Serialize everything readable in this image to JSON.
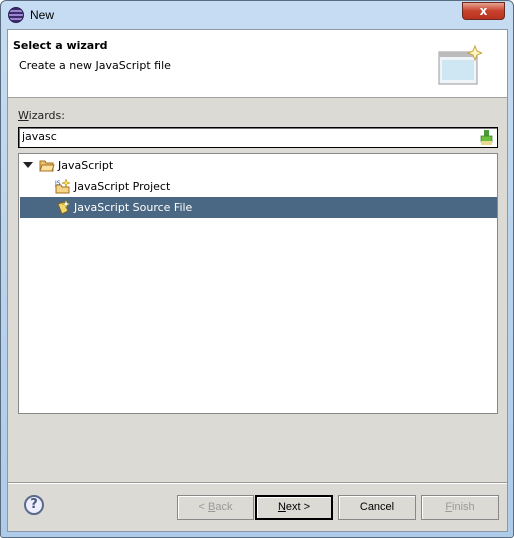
{
  "window": {
    "title": "New",
    "close_label": "x"
  },
  "header": {
    "title": "Select a wizard",
    "description": "Create a new JavaScript file"
  },
  "wizards": {
    "label_mnemonic": "W",
    "label_rest": "izards:",
    "filter_value": "javasc"
  },
  "tree": {
    "items": [
      {
        "label": "JavaScript",
        "icon": "folder-open-icon",
        "expanded": true
      },
      {
        "label": "JavaScript Project",
        "icon": "javascript-project-icon"
      },
      {
        "label": "JavaScript Source File",
        "icon": "javascript-file-icon",
        "selected": true
      }
    ]
  },
  "buttons": {
    "back": {
      "pre": "< ",
      "mn": "B",
      "post": "ack",
      "enabled": false
    },
    "next": {
      "pre": "",
      "mn": "N",
      "post": "ext >",
      "enabled": true
    },
    "cancel": {
      "label": "Cancel"
    },
    "finish": {
      "pre": "",
      "mn": "F",
      "post": "inish",
      "enabled": false
    }
  },
  "colors": {
    "selection": "#4a6883"
  }
}
